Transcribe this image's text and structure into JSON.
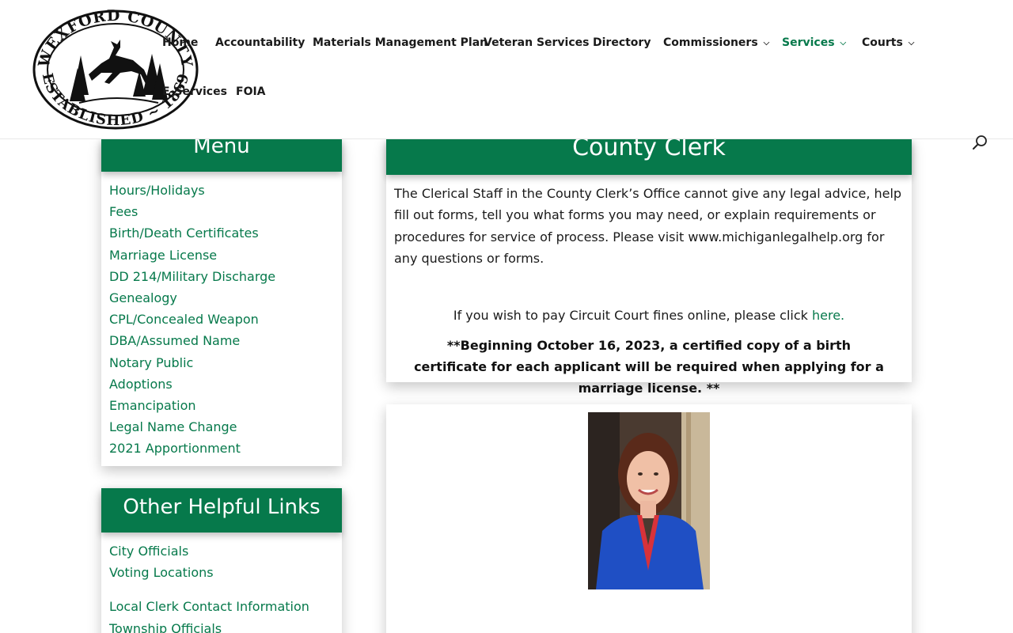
{
  "header": {
    "logo_top_text": "WEXFORD COUNTY",
    "logo_bottom_text": "ESTABLISHED ~ 1869",
    "nav": [
      {
        "label": "Home"
      },
      {
        "label": "Accountability"
      },
      {
        "label": "Materials Management Plan"
      },
      {
        "label": "Veteran Services"
      },
      {
        "label": "Directory"
      },
      {
        "label": "Commissioners"
      },
      {
        "label": "Services"
      },
      {
        "label": "Courts"
      },
      {
        "label": "E-Services"
      },
      {
        "label": "FOIA"
      }
    ],
    "search_icon": "search-icon"
  },
  "menu": {
    "title": "Menu",
    "items": [
      "Hours/Holidays",
      "Fees",
      "Birth/Death Certificates",
      "Marriage License",
      "DD 214/Military Discharge",
      "Genealogy",
      "CPL/Concealed Weapon",
      "DBA/Assumed Name",
      "Notary Public",
      "Adoptions",
      "Emancipation",
      "Legal Name Change",
      "2021 Apportionment"
    ]
  },
  "other_links": {
    "title": "Other Helpful Links",
    "items": [
      "City Officials",
      "Voting Locations",
      "Local Clerk Contact Information",
      "Township Officials"
    ]
  },
  "clerk": {
    "title": "County Clerk",
    "paragraph": "The Clerical Staff in the County Clerk’s Office cannot give any legal advice, help fill out forms, tell you what forms you may need, or explain requirements or procedures for service of process. Please visit www.michiganlegalhelp.org for any questions or forms.",
    "pay_text": "If you wish to pay Circuit Court fines online, please click ",
    "pay_link": "here.",
    "notice": "**Beginning October 16, 2023, a certified copy of a birth certificate for each applicant will be required when applying for a marriage license. **"
  },
  "colors": {
    "accent": "#06794b",
    "text": "#1a1a1a"
  }
}
